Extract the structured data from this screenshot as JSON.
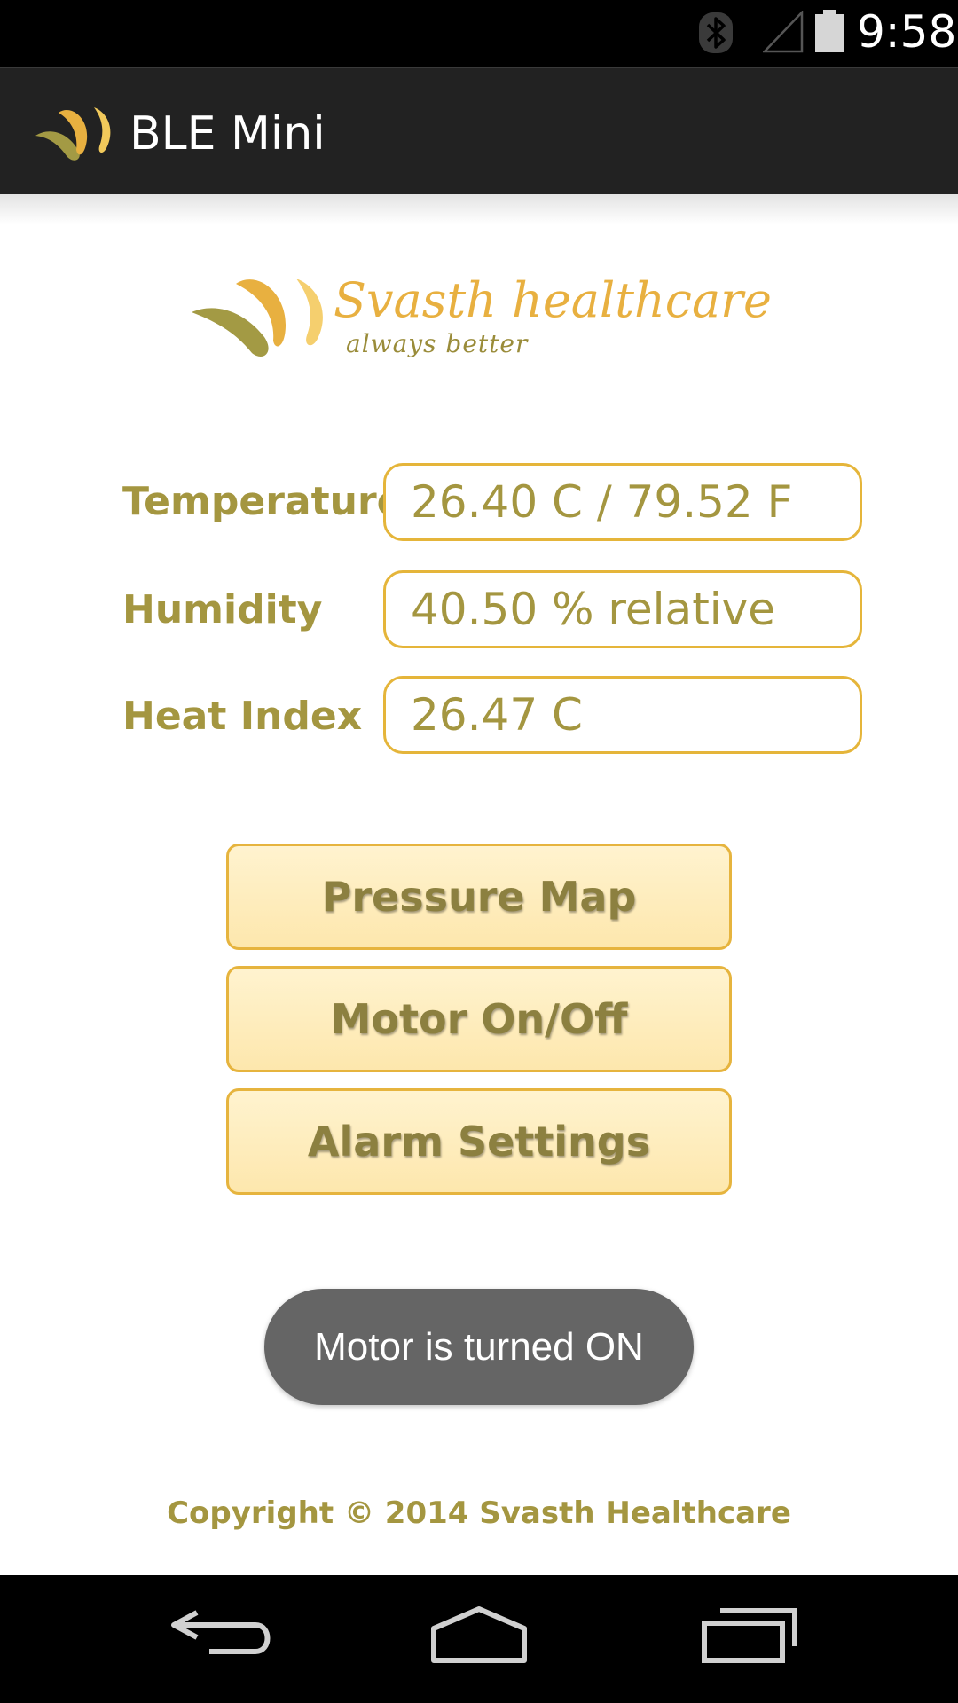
{
  "status_bar": {
    "time": "9:58",
    "icons": [
      "bluetooth-icon",
      "signal-icon",
      "battery-icon"
    ]
  },
  "action_bar": {
    "title": "BLE Mini",
    "background": "#222222"
  },
  "brand": {
    "name": "Svasth healthcare",
    "tagline": "always better",
    "primary_color": "#e8b040",
    "secondary_color": "#9a8c3a"
  },
  "readings": [
    {
      "label": "Temperature",
      "value": "26.40 C / 79.52 F"
    },
    {
      "label": "Humidity",
      "value": "40.50 % relative"
    },
    {
      "label": "Heat Index",
      "value": "26.47 C"
    }
  ],
  "buttons": {
    "pressure_map": "Pressure Map",
    "motor": "Motor On/Off",
    "alarm": "Alarm Settings"
  },
  "toast": {
    "message": "Motor is turned ON"
  },
  "footer": {
    "copyright": "Copyright © 2014 Svasth Healthcare"
  },
  "nav_bar": {
    "icons": [
      "back-icon",
      "home-icon",
      "recents-icon"
    ]
  },
  "colors": {
    "accent": "#e5b53a",
    "label": "#a49640",
    "button_fill": "#fde7ad",
    "toast": "#656565"
  }
}
